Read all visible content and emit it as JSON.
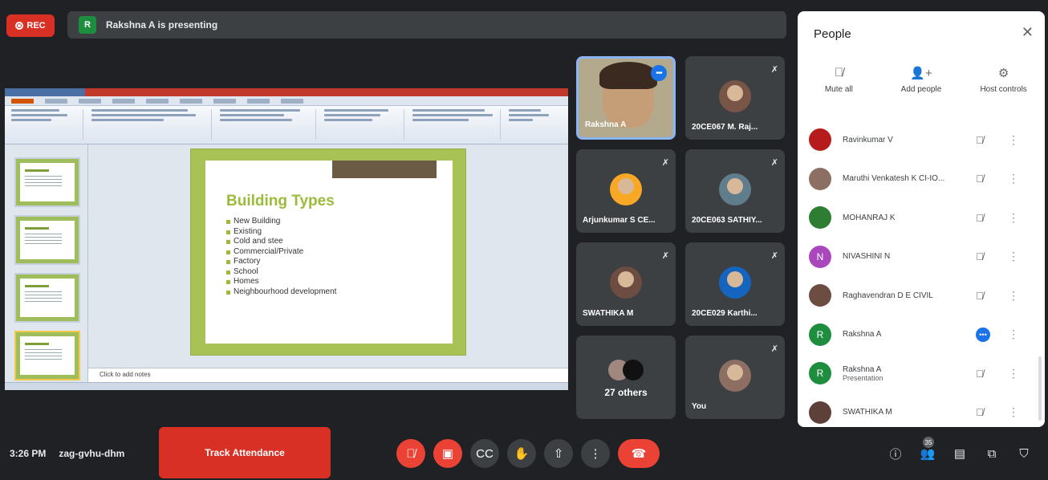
{
  "recording": {
    "label": "REC"
  },
  "presenting": {
    "initial": "R",
    "text": "Rakshna A is presenting"
  },
  "slide": {
    "heading": "Building Types",
    "bullets": [
      "New Building",
      "Existing",
      "Cold and stee",
      "Commercial/Private",
      "Factory",
      "School",
      "Homes",
      "Neighbourhood development"
    ],
    "notes_placeholder": "Click to add notes"
  },
  "tiles": [
    {
      "name": "Rakshna A"
    },
    {
      "name": "20CE067 M. Raj..."
    },
    {
      "name": "Arjunkumar S CE..."
    },
    {
      "name": "20CE063 SATHIY..."
    },
    {
      "name": "SWATHIKA M"
    },
    {
      "name": "20CE029 Karthi..."
    },
    {
      "name": "27 others"
    },
    {
      "name": "You"
    }
  ],
  "people_panel": {
    "title": "People",
    "actions": [
      {
        "label": "Mute all",
        "icon": "mic-off-icon"
      },
      {
        "label": "Add people",
        "icon": "add-person-icon"
      },
      {
        "label": "Host controls",
        "icon": "host-controls-icon"
      }
    ],
    "people": [
      {
        "name": "Ravinkumar V",
        "sub": ""
      },
      {
        "name": "Maruthi Venkatesh K CI-IO...",
        "sub": ""
      },
      {
        "name": "MOHANRAJ K",
        "sub": ""
      },
      {
        "name": "NIVASHINI N",
        "sub": "",
        "initial": "N"
      },
      {
        "name": "Raghavendran D E CIVIL",
        "sub": ""
      },
      {
        "name": "Rakshna A",
        "sub": "",
        "initial": "R"
      },
      {
        "name": "Rakshna A",
        "sub": "Presentation",
        "initial": "R"
      },
      {
        "name": "SWATHIKA M",
        "sub": ""
      }
    ]
  },
  "bottom": {
    "time": "3:26 PM",
    "meeting_code": "zag-gvhu-dhm",
    "attendance_label": "Track Attendance",
    "people_count": "35"
  },
  "colors": {
    "rec_red": "#d93025",
    "speaking_blue": "#1a73e8",
    "meet_dark": "#202124",
    "tile_grey": "#3c4043",
    "slide_green": "#9bbb3a"
  }
}
